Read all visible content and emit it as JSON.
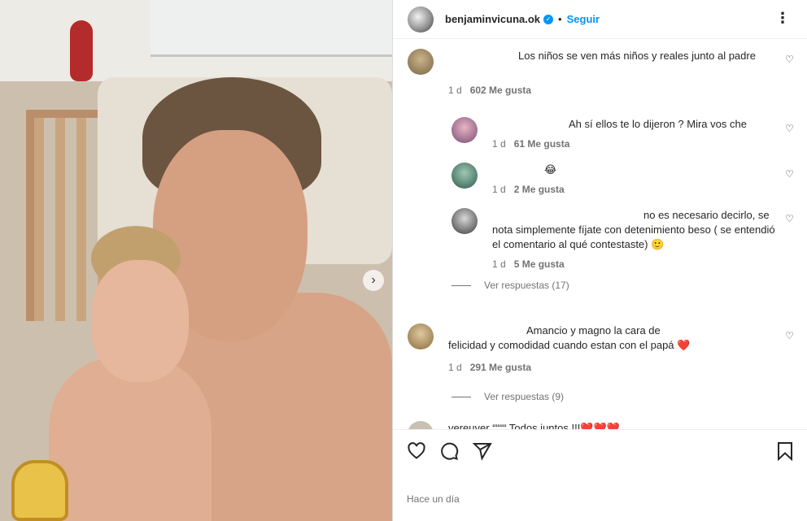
{
  "post": {
    "next_icon": "chevron-right-icon"
  },
  "header": {
    "username": "benjaminvicuna.ok",
    "separator": "•",
    "follow_label": "Seguir",
    "more_label": "⋮"
  },
  "comments": [
    {
      "text": "Los niños se ven más niños y reales junto al padre",
      "time": "1 d",
      "likes": "602 Me gusta"
    },
    {
      "text": "Ah sí ellos te lo dijeron ? Mira vos che",
      "time": "1 d",
      "likes": "61 Me gusta"
    },
    {
      "text": "😂",
      "time": "1 d",
      "likes": "2 Me gusta"
    },
    {
      "text": "no es necesario decirlo, se nota simplemente fíjate con detenimiento beso ( se entendió el comentario al qué contestaste) 🙂",
      "time": "1 d",
      "likes": "5 Me gusta"
    },
    {
      "text": "Amancio y magno la cara de felicidad y comodidad cuando estan con el papá ❤️",
      "time": "1 d",
      "likes": "291 Me gusta"
    }
  ],
  "view_replies": [
    {
      "label": "Ver respuestas (17)"
    },
    {
      "label": "Ver respuestas (9)"
    }
  ],
  "partial_comment": "vereuyer ““““ Todos juntos !!!❤️❤️❤️",
  "footer": {
    "time_ago": "Hace un día"
  },
  "colors": {
    "accent": "#0095f6",
    "muted": "#737373",
    "heart": "#ed4956"
  }
}
